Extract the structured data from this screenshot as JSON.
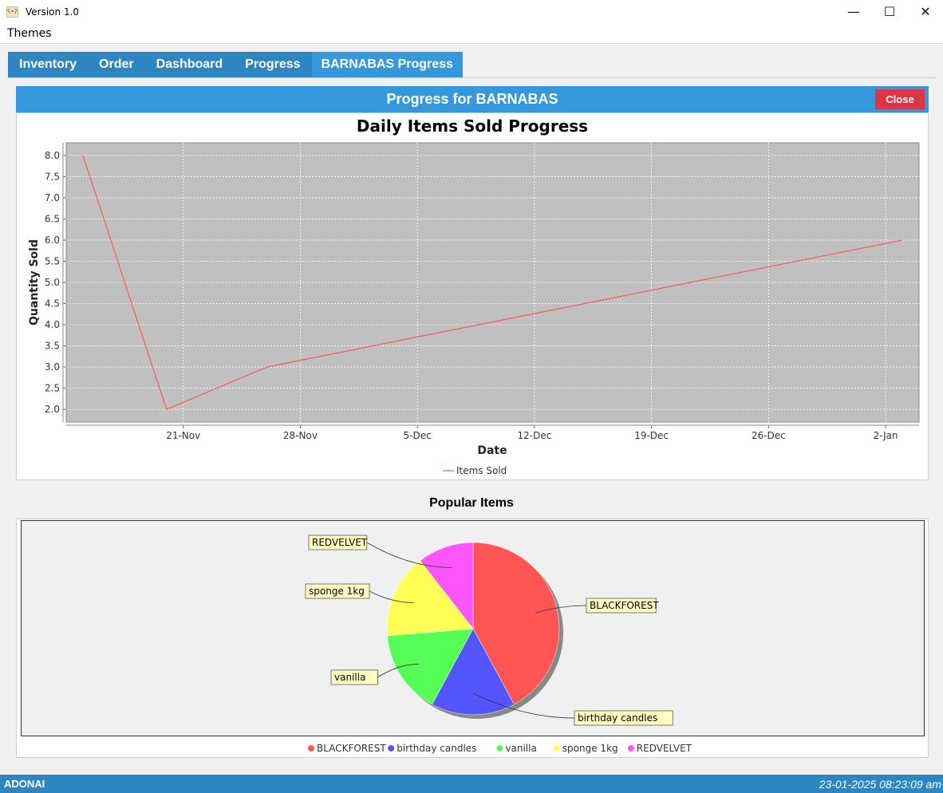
{
  "window": {
    "title": "Version 1.0",
    "minimize": "—",
    "maximize": "☐",
    "close": "✕"
  },
  "menu": {
    "themes": "Themes"
  },
  "tabs": [
    {
      "label": "Inventory"
    },
    {
      "label": "Order"
    },
    {
      "label": "Dashboard"
    },
    {
      "label": "Progress"
    },
    {
      "label": "BARNABAS Progress",
      "active": true
    }
  ],
  "panel": {
    "title": "Progress for BARNABAS",
    "close_label": "Close"
  },
  "colors": {
    "accent": "#3498db",
    "tab_bar": "#2e86c1",
    "close_button": "#dc3545",
    "line": "#ff5555",
    "plot_bg": "#c0c0c0"
  },
  "chart_data": [
    {
      "type": "line",
      "title": "Daily Items Sold Progress",
      "xlabel": "Date",
      "ylabel": "Quantity Sold",
      "series": [
        {
          "name": "Items Sold",
          "color": "#ff5555",
          "points": [
            {
              "x": "2024-11-15",
              "y": 8.0
            },
            {
              "x": "2024-11-20",
              "y": 2.0
            },
            {
              "x": "2024-11-26",
              "y": 3.0
            },
            {
              "x": "2025-01-03",
              "y": 6.0
            }
          ]
        }
      ],
      "x_ticks": [
        "21-Nov",
        "28-Nov",
        "5-Dec",
        "12-Dec",
        "19-Dec",
        "26-Dec",
        "2-Jan"
      ],
      "y_ticks": [
        "2.0",
        "2.5",
        "3.0",
        "3.5",
        "4.0",
        "4.5",
        "5.0",
        "5.5",
        "6.0",
        "6.5",
        "7.0",
        "7.5",
        "8.0"
      ],
      "ylim": [
        1.7,
        8.3
      ],
      "xlim": [
        "2024-11-14",
        "2025-01-04"
      ],
      "grid": true,
      "legend": "bottom"
    },
    {
      "type": "pie",
      "title": "Popular Items",
      "slices": [
        {
          "label": "BLACKFOREST",
          "value": 40,
          "color": "#ff5555"
        },
        {
          "label": "birthday candles",
          "value": 15,
          "color": "#5555ff"
        },
        {
          "label": "vanilla",
          "value": 15,
          "color": "#55ff55"
        },
        {
          "label": "sponge 1kg",
          "value": 15,
          "color": "#ffff55"
        },
        {
          "label": "REDVELVET",
          "value": 10,
          "color": "#ff55ff"
        }
      ],
      "legend": "bottom"
    }
  ],
  "status": {
    "user": "ADONAI",
    "datetime": "23-01-2025 08:23:09 am"
  }
}
